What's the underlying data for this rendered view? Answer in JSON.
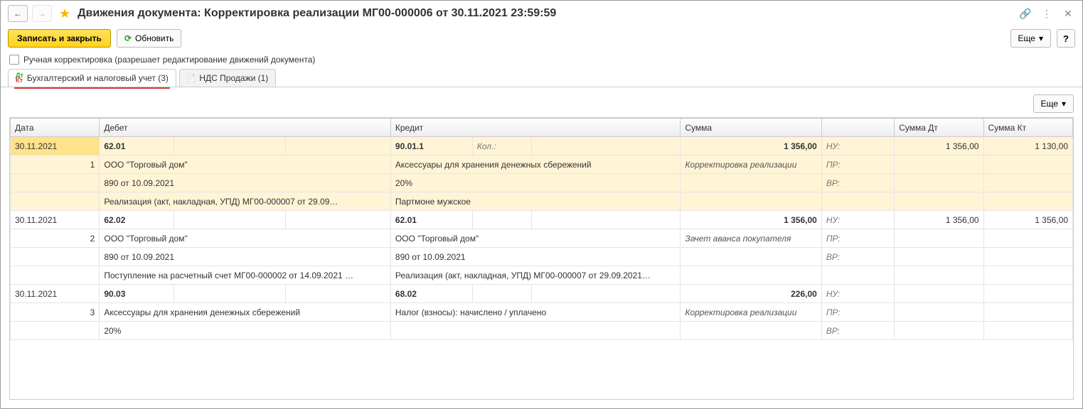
{
  "header": {
    "title": "Движения документа: Корректировка реализации МГ00-000006 от 30.11.2021 23:59:59"
  },
  "toolbar": {
    "save_close": "Записать и закрыть",
    "refresh": "Обновить",
    "more": "Еще"
  },
  "checkbox": {
    "label": "Ручная корректировка (разрешает редактирование движений документа)"
  },
  "tabs": {
    "accounting": "Бухгалтерский и налоговый учет (3)",
    "vat": "НДС Продажи (1)"
  },
  "grid": {
    "cols": {
      "date": "Дата",
      "debit": "Дебет",
      "credit": "Кредит",
      "sum": "Сумма",
      "sum_dt": "Сумма Дт",
      "sum_kt": "Сумма Кт"
    },
    "labels": {
      "qty": "Кол.:",
      "nu": "НУ:",
      "pr": "ПР:",
      "vr": "ВР:"
    },
    "rows": [
      {
        "yellow": true,
        "date": "30.11.2021",
        "idx": "1",
        "debit_acc": "62.01",
        "credit_acc": "90.01.1",
        "sum": "1 356,00",
        "sum_dt": "1 356,00",
        "sum_kt": "1 130,00",
        "debit_lines": [
          "ООО \"Торговый дом\"",
          "890 от 10.09.2021",
          "Реализация (акт, накладная, УПД) МГ00-000007 от 29.09…"
        ],
        "credit_lines": [
          "Аксессуары для хранения денежных сбережений",
          "20%",
          "Партмоне мужское"
        ],
        "sum_desc": "Корректировка реализации"
      },
      {
        "yellow": false,
        "date": "30.11.2021",
        "idx": "2",
        "debit_acc": "62.02",
        "credit_acc": "62.01",
        "sum": "1 356,00",
        "sum_dt": "1 356,00",
        "sum_kt": "1 356,00",
        "debit_lines": [
          "ООО \"Торговый дом\"",
          "890 от 10.09.2021",
          "Поступление на расчетный счет МГ00-000002 от 14.09.2021 …"
        ],
        "credit_lines": [
          "ООО \"Торговый дом\"",
          "890 от 10.09.2021",
          "Реализация (акт, накладная, УПД) МГ00-000007 от 29.09.2021…"
        ],
        "sum_desc": "Зачет аванса покупателя"
      },
      {
        "yellow": false,
        "date": "30.11.2021",
        "idx": "3",
        "debit_acc": "90.03",
        "credit_acc": "68.02",
        "sum": "226,00",
        "sum_dt": "",
        "sum_kt": "",
        "debit_lines": [
          "Аксессуары для хранения денежных сбережений",
          "20%"
        ],
        "credit_lines": [
          "Налог (взносы): начислено / уплачено",
          ""
        ],
        "sum_desc": "Корректировка реализации"
      }
    ]
  }
}
